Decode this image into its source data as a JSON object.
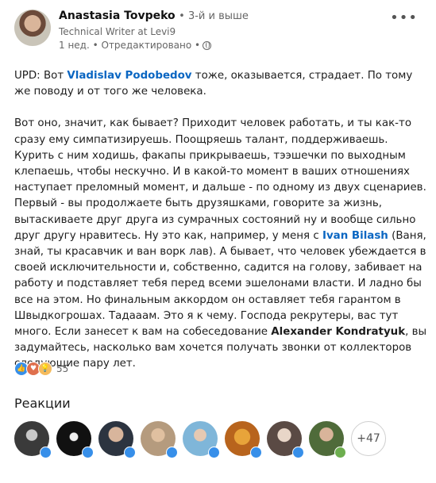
{
  "author": {
    "name": "Anastasia Tovpeko",
    "degree": "• 3-й и выше",
    "headline": "Technical Writer at Levi9",
    "meta": "1 нед. • Отредактировано •"
  },
  "post": {
    "p1": {
      "pre": "UPD: Вот ",
      "mention": "Vladislav Podobedov",
      "post": " тоже, оказывается, страдает. По тому же поводу и от того же человека."
    },
    "p2": {
      "a": "Вот оно, значит, как бывает? Приходит человек работать, и ты как-то сразу ему симпатизируешь. Поощряешь  талант, поддерживаешь. Курить с ним ходишь, факапы прикрываешь, тээшечки по выходным клепаешь, чтобы нескучно. И в какой-то момент в ваших отношениях наступает преломный момент, и дальше - по одному из двух сценариев. Первый - вы продолжаете быть друзяшками, говорите за жизнь, вытаскиваете друг друга из сумрачных состояний ну и вообще сильно друг другу нравитесь. Ну это как, например, у меня с ",
      "mention1": "Ivan Bilash",
      "b": "  (Ваня, знай, ты красавчик и ван ворк лав). А бывает, что человек убеждается в своей исключительности и, собственно, садится на голову, забивает на работу и подставляет тебя перед всеми эшелонами власти. И ладно бы все на этом. Но финальным аккордом он оставляет тебя гарантом в Швыдкогрошах. Тадааам. Это я к чему. Господа рекрутеры, вас тут много. Если занесет к вам на собеседование ",
      "mention2": "Alexander Kondratyuk",
      "c": ", вы задумайтесь, насколько вам хочется получать звонки от коллекторов следующие пару лет."
    }
  },
  "reactions": {
    "count": "55",
    "title": "Реакции",
    "more": "+47",
    "icons": [
      "like-icon",
      "love-icon",
      "insightful-icon"
    ]
  },
  "colors": {
    "link": "#0a66c2",
    "like": "#378fe9",
    "love": "#df704d",
    "insight": "#f5bb5c",
    "support": "#6dae4f"
  }
}
